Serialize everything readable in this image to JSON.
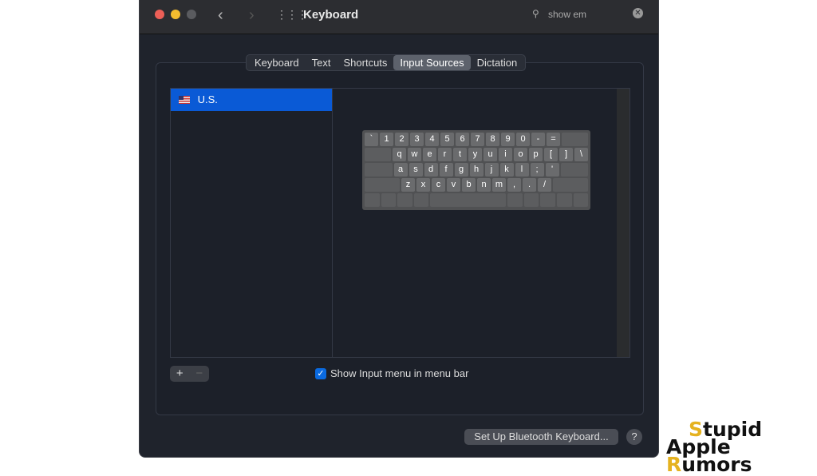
{
  "window": {
    "title": "Keyboard",
    "search_value": "show em"
  },
  "tabs": [
    {
      "label": "Keyboard"
    },
    {
      "label": "Text"
    },
    {
      "label": "Shortcuts"
    },
    {
      "label": "Input Sources",
      "selected": true
    },
    {
      "label": "Dictation"
    }
  ],
  "sources": [
    {
      "label": "U.S.",
      "icon": "us-flag-icon"
    }
  ],
  "keyboard_rows": [
    [
      "`",
      "1",
      "2",
      "3",
      "4",
      "5",
      "6",
      "7",
      "8",
      "9",
      "0",
      "-",
      "=",
      "*"
    ],
    [
      "*",
      "q",
      "w",
      "e",
      "r",
      "t",
      "y",
      "u",
      "i",
      "o",
      "p",
      "[",
      "]",
      "\\"
    ],
    [
      "*",
      "a",
      "s",
      "d",
      "f",
      "g",
      "h",
      "j",
      "k",
      "l",
      ";",
      "'",
      "*"
    ],
    [
      "*",
      "z",
      "x",
      "c",
      "v",
      "b",
      "n",
      "m",
      ",",
      ".",
      "/",
      "*"
    ],
    [
      "",
      "",
      "",
      "",
      "",
      "",
      "",
      "",
      "",
      ""
    ]
  ],
  "list_controls": {
    "add": "+",
    "remove": "−"
  },
  "show_input_menu": {
    "label": "Show Input menu in menu bar",
    "checked": true
  },
  "bluetooth_button": "Set Up Bluetooth Keyboard...",
  "help_button": "?",
  "watermark": {
    "line1": "Stupid",
    "line2": "Apple Rumors"
  },
  "colors": {
    "accent": "#0a5ad6",
    "close": "#ec5f57",
    "minimize": "#f5bd2f",
    "disabled": "#5a5b5f"
  }
}
